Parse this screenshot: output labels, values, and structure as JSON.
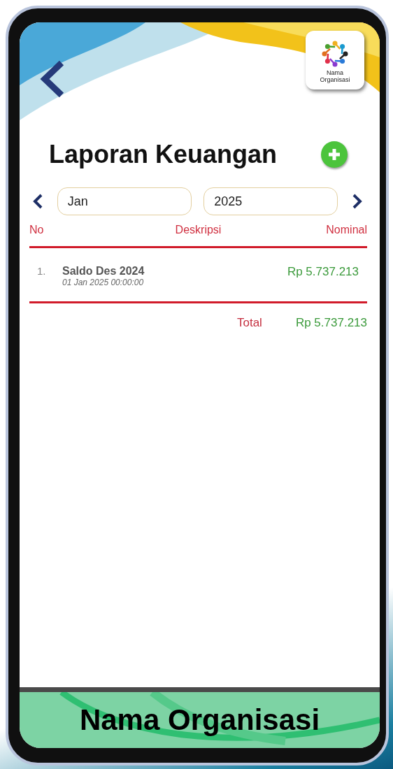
{
  "header": {
    "logo_text": "Nama Organisasi"
  },
  "title": "Laporan Keuangan",
  "period": {
    "month": "Jan",
    "year": "2025"
  },
  "table": {
    "columns": [
      "No",
      "Deskripsi",
      "Nominal"
    ],
    "rows": [
      {
        "no": "1.",
        "description": "Saldo Des 2024",
        "date": "01 Jan 2025 00:00:00",
        "amount": "Rp 5.737.213"
      }
    ],
    "total": {
      "label": "Total",
      "amount": "Rp 5.737.213"
    }
  },
  "footer": {
    "title": "Nama Organisasi"
  }
}
